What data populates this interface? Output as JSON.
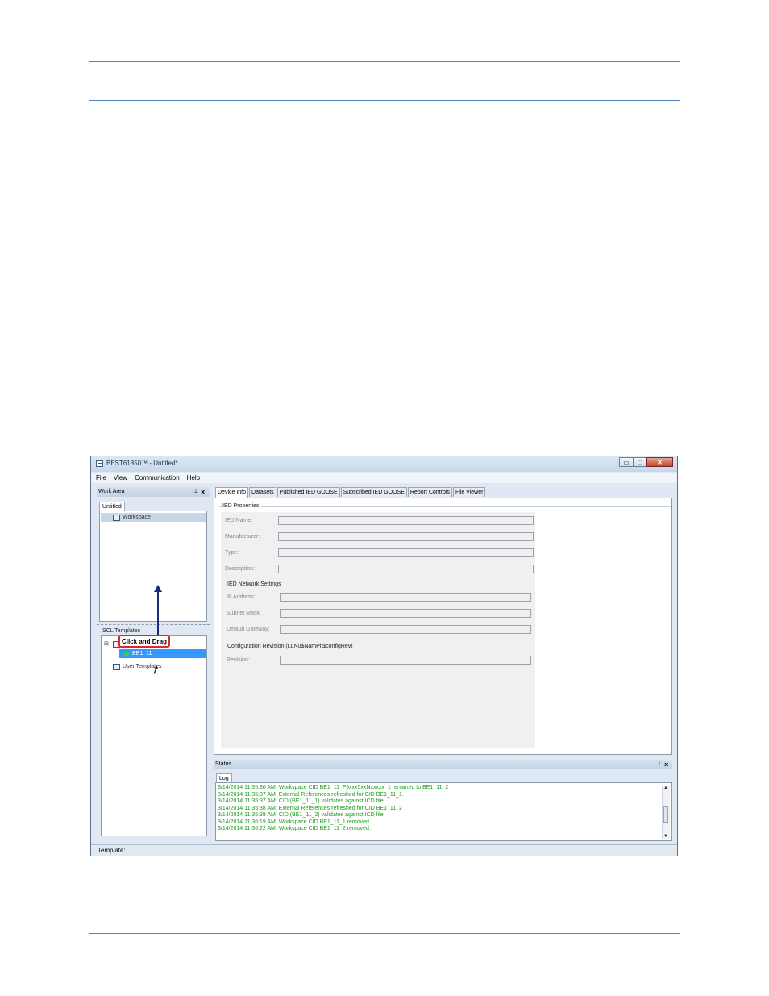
{
  "window": {
    "title": "BEST61850™ - Untitled*",
    "buttons": {
      "minimize": "▭",
      "maximize": "□",
      "close": "✕"
    }
  },
  "menu": [
    "File",
    "View",
    "Communication",
    "Help"
  ],
  "work_area": {
    "header": "Work Area",
    "tab": "Untitled",
    "workspace_label": "Workspace"
  },
  "sql_templates": {
    "header": "SCL Templates",
    "selected_item": "BE1_11",
    "user_templates": "User Templates",
    "callout": "Click and Drag"
  },
  "tabs": [
    "Device Info",
    "Datasets",
    "Published IED GOOSE",
    "Subscribed IED GOOSE",
    "Report Controls",
    "File Viewer"
  ],
  "device_info": {
    "group_title": "IED Properties",
    "fields": [
      "IED Name:",
      "Manufacturer:",
      "Type:",
      "Description:"
    ],
    "network_title": "IED Network Settings",
    "network_fields": [
      "IP Address:",
      "Subnet Mask:",
      "Default Gateway:"
    ],
    "revision_title": "Configuration Revision (LLN0$NamPlt$configRev)",
    "revision_field": "Revision:"
  },
  "status": {
    "header": "Status",
    "tab": "Log",
    "log_lines": [
      "3/14/2014 11:35:30 AM: Workspace CID BE1_11_F5xxx5xxNxxxxx_1 renamed to BE1_11_2",
      "3/14/2014 11:35:37 AM: External References refreshed for CID BE1_11_1.",
      "3/14/2014 11:35:37 AM: CID (BE1_11_1) validates against ICD file.",
      "3/14/2014 11:35:38 AM: External References refreshed for CID BE1_11_2",
      "3/14/2014 11:35:38 AM: CID (BE1_11_2) validates against ICD file.",
      "3/14/2014 11:36:19 AM: Workspace CID BE1_11_1 removed.",
      "3/14/2014 11:36:22 AM: Workspace CID BE1_11_2 removed."
    ]
  },
  "statusbar": "Template:"
}
